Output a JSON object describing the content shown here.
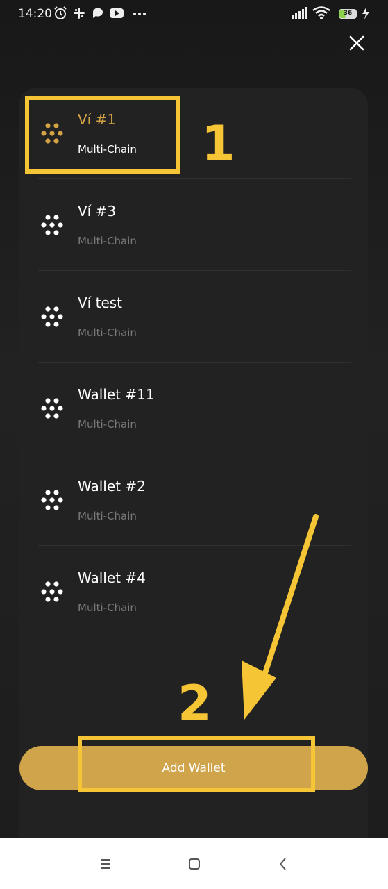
{
  "status_bar": {
    "time": "14:20",
    "battery": "36",
    "icons": [
      "alarm-icon",
      "slack-icon",
      "chat-bubble-icon",
      "youtube-icon",
      "more-dots-icon",
      "signal-icon",
      "wifi-icon",
      "battery-icon",
      "charging-icon"
    ]
  },
  "header": {
    "close_icon": "close-icon"
  },
  "wallets": [
    {
      "name": "Ví #1",
      "subtitle": "Multi-Chain",
      "active": true
    },
    {
      "name": "Ví #3",
      "subtitle": "Multi-Chain",
      "active": false
    },
    {
      "name": "Ví test",
      "subtitle": "Multi-Chain",
      "active": false
    },
    {
      "name": "Wallet #11",
      "subtitle": "Multi-Chain",
      "active": false
    },
    {
      "name": "Wallet #2",
      "subtitle": "Multi-Chain",
      "active": false
    },
    {
      "name": "Wallet #4",
      "subtitle": "Multi-Chain",
      "active": false
    }
  ],
  "add_wallet_label": "Add Wallet",
  "annotations": {
    "step_one": "1",
    "step_two": "2"
  },
  "nav_bar": {
    "icons": [
      "menu-icon",
      "home-square-icon",
      "back-chevron-icon"
    ]
  },
  "colors": {
    "accent": "#cfa44a",
    "active_name": "#d4a444",
    "annotation": "#f5c535",
    "sheet_bg": "#222222",
    "page_bg": "#1c1c1c"
  }
}
